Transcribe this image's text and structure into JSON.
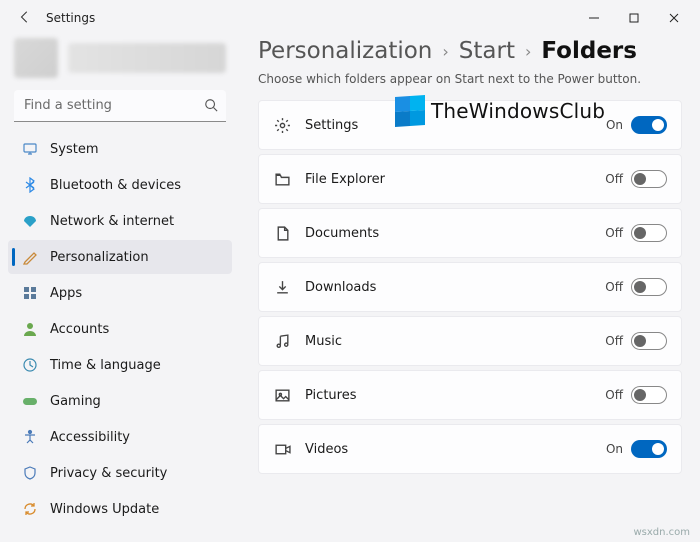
{
  "app": {
    "title": "Settings"
  },
  "window_controls": {
    "minimize": "minimize",
    "maximize": "maximize",
    "close": "close"
  },
  "search": {
    "placeholder": "Find a setting"
  },
  "sidebar": {
    "items": [
      {
        "label": "System",
        "icon": "system-icon",
        "active": false
      },
      {
        "label": "Bluetooth & devices",
        "icon": "bluetooth-icon",
        "active": false
      },
      {
        "label": "Network & internet",
        "icon": "network-icon",
        "active": false
      },
      {
        "label": "Personalization",
        "icon": "personalization-icon",
        "active": true
      },
      {
        "label": "Apps",
        "icon": "apps-icon",
        "active": false
      },
      {
        "label": "Accounts",
        "icon": "accounts-icon",
        "active": false
      },
      {
        "label": "Time & language",
        "icon": "time-language-icon",
        "active": false
      },
      {
        "label": "Gaming",
        "icon": "gaming-icon",
        "active": false
      },
      {
        "label": "Accessibility",
        "icon": "accessibility-icon",
        "active": false
      },
      {
        "label": "Privacy & security",
        "icon": "privacy-security-icon",
        "active": false
      },
      {
        "label": "Windows Update",
        "icon": "windows-update-icon",
        "active": false
      }
    ]
  },
  "breadcrumb": {
    "parts": [
      "Personalization",
      "Start",
      "Folders"
    ]
  },
  "subtitle": "Choose which folders appear on Start next to the Power button.",
  "folders": [
    {
      "label": "Settings",
      "icon": "gear-icon",
      "state": "On",
      "on": true
    },
    {
      "label": "File Explorer",
      "icon": "file-explorer-icon",
      "state": "Off",
      "on": false
    },
    {
      "label": "Documents",
      "icon": "document-icon",
      "state": "Off",
      "on": false
    },
    {
      "label": "Downloads",
      "icon": "download-icon",
      "state": "Off",
      "on": false
    },
    {
      "label": "Music",
      "icon": "music-icon",
      "state": "Off",
      "on": false
    },
    {
      "label": "Pictures",
      "icon": "pictures-icon",
      "state": "Off",
      "on": false
    },
    {
      "label": "Videos",
      "icon": "videos-icon",
      "state": "On",
      "on": true
    }
  ],
  "watermark": {
    "text": "TheWindowsClub"
  },
  "footer": "wsxdn.com"
}
